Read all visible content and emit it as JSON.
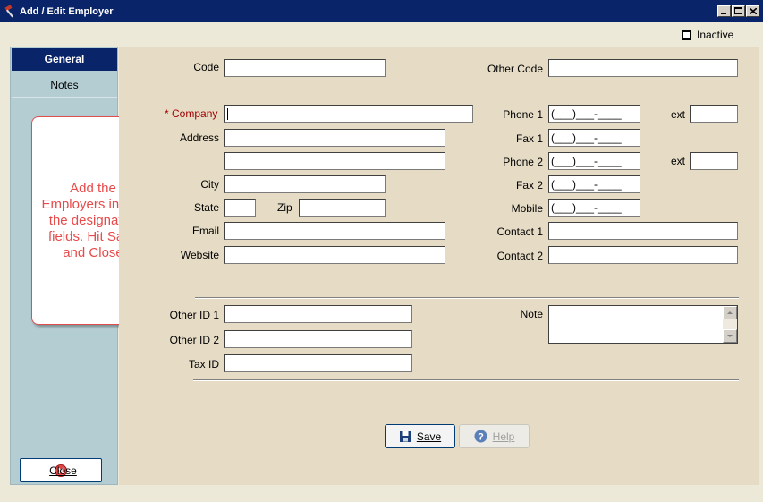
{
  "window": {
    "title": "Add / Edit Employer",
    "controls": [
      "minimize",
      "maximize",
      "close"
    ]
  },
  "inactive": {
    "label": "Inactive",
    "checked": false
  },
  "sidebar": {
    "tabs": [
      {
        "label": "General",
        "active": true
      },
      {
        "label": "Notes",
        "active": false
      }
    ],
    "callout": "Add the Employers info in the designated fields. Hit Save and Close",
    "close_label": "Close"
  },
  "form": {
    "code_label": "Code",
    "other_code_label": "Other Code",
    "company_label_required": "*",
    "company_label": "Company",
    "address_label": "Address",
    "city_label": "City",
    "state_label": "State",
    "zip_label": "Zip",
    "email_label": "Email",
    "website_label": "Website",
    "phone1_label": "Phone 1",
    "fax1_label": "Fax 1",
    "phone2_label": "Phone 2",
    "fax2_label": "Fax 2",
    "mobile_label": "Mobile",
    "ext_label": "ext",
    "contact1_label": "Contact 1",
    "contact2_label": "Contact 2",
    "other_id1_label": "Other ID 1",
    "other_id2_label": "Other ID 2",
    "tax_id_label": "Tax ID",
    "note_label": "Note",
    "phone_mask": "(___)___-____"
  },
  "buttons": {
    "save_label": "Save",
    "help_label": "Help"
  },
  "colors": {
    "titlebar": "#0a246a",
    "sidebar": "#b4cdd3",
    "form_bg": "#e6dcc6",
    "callout_text": "#e84a4a"
  }
}
